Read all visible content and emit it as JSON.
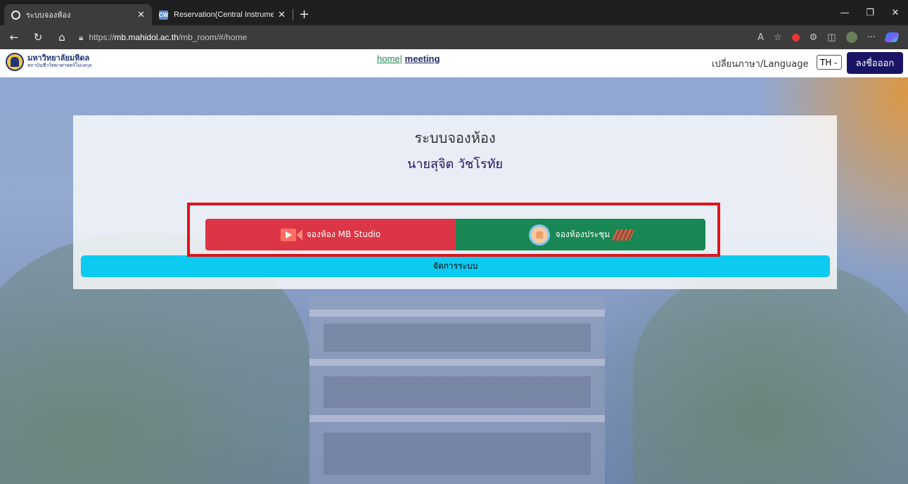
{
  "browser": {
    "tabs": [
      {
        "title": "ระบบจองห้อง",
        "active": true
      },
      {
        "title": "Reservation(Central Instrument)",
        "active": false
      }
    ],
    "url_prefix": "https://",
    "url_host": "mb.mahidol.ac.th",
    "url_path": "/mb_room/#/home",
    "icons": [
      "back-icon",
      "refresh-icon",
      "home-icon",
      "lock-icon",
      "read-aloud-icon",
      "favorite-icon",
      "extensions-icon",
      "split-screen-icon",
      "profile-icon",
      "more-icon",
      "copilot-icon"
    ]
  },
  "header": {
    "logo_main": "มหาวิทยาลัยมหิดล",
    "logo_sub": "สถาบันชีววิทยาศาสตร์โมเลกุล",
    "nav_home": "home",
    "nav_sep": "|",
    "nav_meeting": "meeting",
    "language_label": "เปลี่ยนภาษา/Language",
    "language_value": "TH",
    "logout_label": "ลงชื่อออก"
  },
  "card": {
    "title": "ระบบจองห้อง",
    "user_name": "นายสุจิต วัชโรทัย",
    "studio_button": "จองห้อง MB Studio",
    "meeting_button": "จองห้องประชุม",
    "admin_button": "จัดการระบบ"
  },
  "colors": {
    "logout": "#1b1464",
    "studio": "#dc3545",
    "meeting": "#198754",
    "admin": "#0dcaf0",
    "highlight": "#e0141a"
  }
}
